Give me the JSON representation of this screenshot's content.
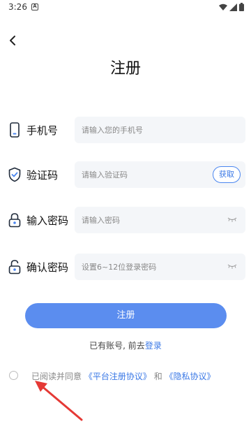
{
  "status": {
    "time": "3:26",
    "notification_glyph": "A"
  },
  "header": {
    "title": "注册"
  },
  "form": {
    "phone": {
      "label": "手机号",
      "placeholder": "请输入您的手机号"
    },
    "code": {
      "label": "验证码",
      "placeholder": "请输入验证码",
      "button": "获取"
    },
    "password": {
      "label": "输入密码",
      "placeholder": "请输入密码"
    },
    "confirm": {
      "label": "确认密码",
      "placeholder": "设置6~12位登录密码"
    }
  },
  "submit_label": "注册",
  "login": {
    "prompt": "已有账号, 前去",
    "link": "登录"
  },
  "agreement": {
    "prefix": "已阅读并同意",
    "platform_link": "《平台注册协议》",
    "conjunction": "和",
    "privacy_link": "《隐私协议》"
  },
  "colors": {
    "accent": "#5b8def",
    "link": "#3a78e6",
    "field_bg": "#f4f6f9",
    "annotation_arrow": "#e53935"
  }
}
